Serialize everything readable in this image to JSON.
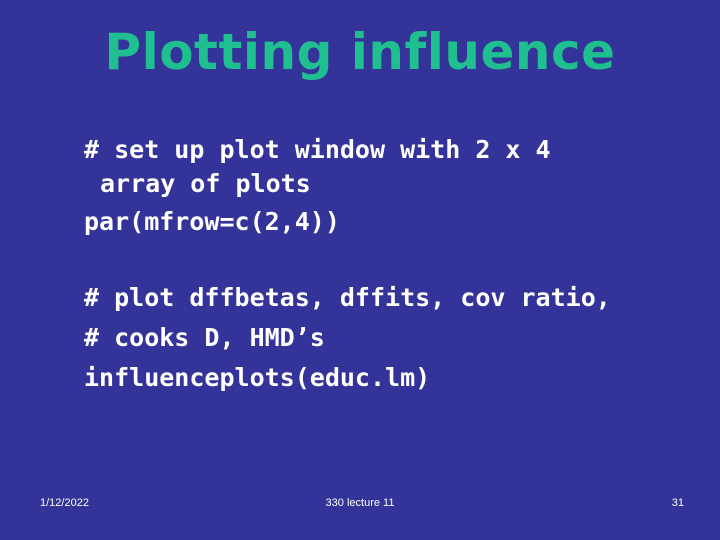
{
  "slide": {
    "background_color": "#333399",
    "title": "Plotting influence",
    "title_color": "#1FBF8F",
    "body_text_color": "#FFFFFF"
  },
  "content": {
    "blocks": [
      {
        "lines": [
          "# set up plot window with 2 x 4",
          "array of plots",
          "par(mfrow=c(2,4))"
        ]
      },
      {
        "lines": [
          "# plot dffbetas, dffits, cov ratio,",
          "# cooks D, HMD’s",
          "influenceplots(educ.lm)"
        ]
      }
    ]
  },
  "footer": {
    "date": "1/12/2022",
    "center": "330 lecture 11",
    "page_number": "31"
  }
}
